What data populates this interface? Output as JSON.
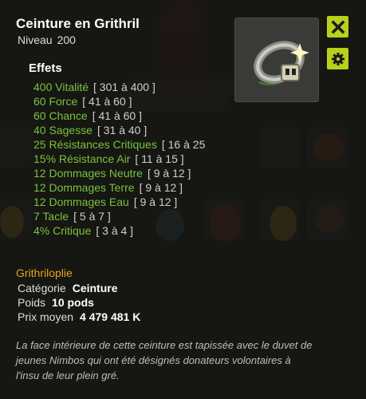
{
  "item": {
    "name": "Ceinture en Grithril",
    "level_label": "Niveau",
    "level": "200"
  },
  "buttons": {
    "close_icon": "close-icon",
    "settings_icon": "gear-icon"
  },
  "effects_heading": "Effets",
  "effects": [
    {
      "text": "400 Vitalité",
      "range": "[ 301 à 400 ]"
    },
    {
      "text": "60 Force",
      "range": "[ 41 à 60 ]"
    },
    {
      "text": "60 Chance",
      "range": "[ 41 à 60 ]"
    },
    {
      "text": "40 Sagesse",
      "range": "[ 31 à 40 ]"
    },
    {
      "text": "25 Résistances Critiques",
      "range": "[ 16 à 25"
    },
    {
      "text": "15% Résistance Air",
      "range": "[ 11 à 15 ]"
    },
    {
      "text": "12 Dommages Neutre",
      "range": "[ 9 à 12 ]"
    },
    {
      "text": "12 Dommages Terre",
      "range": "[ 9 à 12 ]"
    },
    {
      "text": "12 Dommages Eau",
      "range": "[ 9 à 12 ]"
    },
    {
      "text": "7 Tacle",
      "range": "[ 5 à 7 ]"
    },
    {
      "text": "4% Critique",
      "range": "[ 3 à 4 ]"
    }
  ],
  "set_name": "Grithriloplie",
  "props": {
    "category_label": "Catégorie",
    "category": "Ceinture",
    "weight_label": "Poids",
    "weight": "10 pods",
    "price_label": "Prix moyen",
    "price": "4 479 481 K"
  },
  "description": "La face intérieure de cette ceinture est tapissée avec le duvet de jeunes Nimbos qui ont été désignés donateurs volontaires à l'insu de leur plein gré.",
  "colors": {
    "effect_green": "#79c33e",
    "set_orange": "#e6a51c",
    "button_lime": "#b8d11a"
  }
}
